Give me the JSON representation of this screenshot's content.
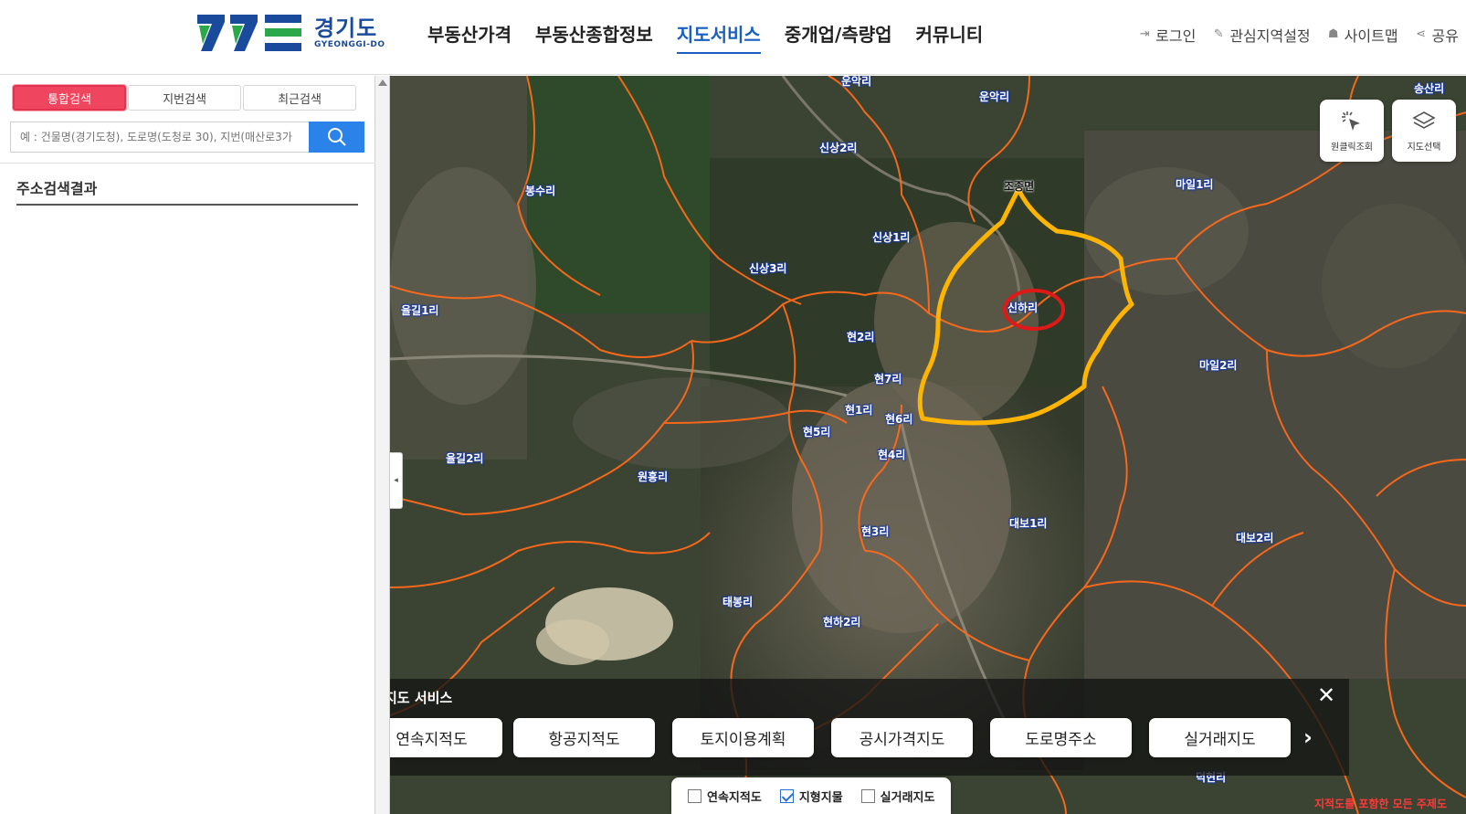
{
  "header": {
    "logo_ko": "경기도",
    "logo_en": "GYEONGGI-DO",
    "nav": [
      {
        "label": "부동산가격",
        "active": false
      },
      {
        "label": "부동산종합정보",
        "active": false
      },
      {
        "label": "지도서비스",
        "active": true
      },
      {
        "label": "중개업/측량업",
        "active": false
      },
      {
        "label": "커뮤니티",
        "active": false
      }
    ],
    "util": [
      {
        "label": "로그인",
        "icon": "login-icon"
      },
      {
        "label": "관심지역설정",
        "icon": "pin-icon"
      },
      {
        "label": "사이트맵",
        "icon": "sitemap-icon"
      },
      {
        "label": "공유",
        "icon": "share-icon"
      }
    ]
  },
  "search": {
    "tabs": [
      {
        "label": "통합검색",
        "active": true
      },
      {
        "label": "지번검색",
        "active": false
      },
      {
        "label": "최근검색",
        "active": false
      }
    ],
    "placeholder": "예 : 건물명(경기도청), 도로명(도청로 30), 지번(매산로3가",
    "result_title": "주소검색결과"
  },
  "map": {
    "buttons": [
      {
        "label": "원클릭조회",
        "icon": "cursor-click-icon"
      },
      {
        "label": "지도선택",
        "icon": "layers-icon"
      }
    ],
    "places": [
      {
        "name": "운악리",
        "dark": false
      },
      {
        "name": "운악리",
        "dark": false
      },
      {
        "name": "송산리",
        "dark": false
      },
      {
        "name": "신상2리",
        "dark": false
      },
      {
        "name": "봉수리",
        "dark": false
      },
      {
        "name": "조종면",
        "dark": true
      },
      {
        "name": "마일1리",
        "dark": false
      },
      {
        "name": "신상1리",
        "dark": false
      },
      {
        "name": "신상3리",
        "dark": false
      },
      {
        "name": "신하리",
        "dark": false
      },
      {
        "name": "율길1리",
        "dark": false
      },
      {
        "name": "현2리",
        "dark": false
      },
      {
        "name": "마일2리",
        "dark": false
      },
      {
        "name": "현7리",
        "dark": false
      },
      {
        "name": "현1리",
        "dark": false
      },
      {
        "name": "현6리",
        "dark": false
      },
      {
        "name": "현5리",
        "dark": false
      },
      {
        "name": "현4리",
        "dark": false
      },
      {
        "name": "율길2리",
        "dark": false
      },
      {
        "name": "원흥리",
        "dark": false
      },
      {
        "name": "대보1리",
        "dark": false
      },
      {
        "name": "현3리",
        "dark": false
      },
      {
        "name": "대보2리",
        "dark": false
      },
      {
        "name": "태봉리",
        "dark": false
      },
      {
        "name": "현하2리",
        "dark": false
      },
      {
        "name": "덕현리",
        "dark": false
      }
    ],
    "service_title": "지도 서비스",
    "services": [
      "연속지적도",
      "항공지적도",
      "토지이용계획",
      "공시가격지도",
      "도로명주소",
      "실거래지도"
    ],
    "layers": [
      {
        "label": "연속지적도",
        "checked": false
      },
      {
        "label": "지형지물",
        "checked": true
      },
      {
        "label": "실거래지도",
        "checked": false
      }
    ],
    "footnote": "지적도를 포함한 모든 주제도",
    "colors": {
      "boundary": "#ff6a1a",
      "highlight": "#ffb400",
      "circle": "#e01818",
      "accent": "#2b82e8",
      "tab_active": "#f0455e"
    }
  }
}
